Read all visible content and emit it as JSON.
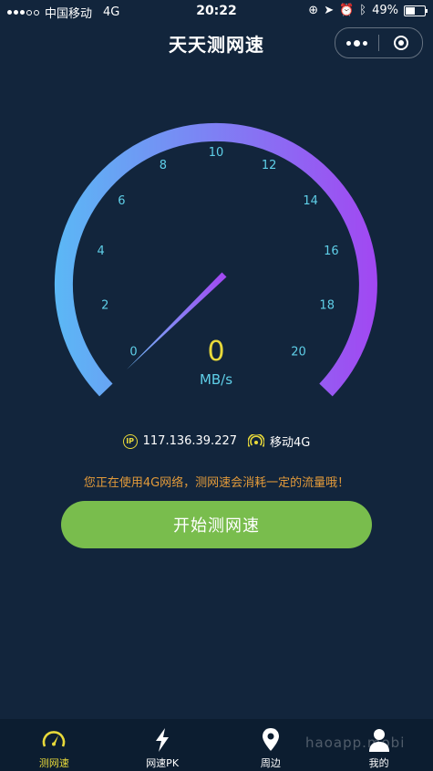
{
  "status_bar": {
    "carrier": "中国移动",
    "network": "4G",
    "time": "20:22",
    "battery": "49%",
    "battery_level": 0.49
  },
  "header": {
    "title": "天天测网速"
  },
  "gauge": {
    "ticks": [
      "0",
      "2",
      "4",
      "6",
      "8",
      "10",
      "12",
      "14",
      "16",
      "18",
      "20"
    ],
    "value": "0",
    "unit": "MB/s",
    "colors": {
      "start": "#5bb8f5",
      "end": "#a247f2"
    }
  },
  "network_info": {
    "ip": "117.136.39.227",
    "carrier_network": "移动4G",
    "ip_badge": "IP"
  },
  "warning": "您正在使用4G网络，测网速会消耗一定的流量哦！",
  "start_button": "开始测网速",
  "tabs": [
    {
      "label": "测网速",
      "icon": "speedometer-icon",
      "active": true
    },
    {
      "label": "网速PK",
      "icon": "lightning-icon",
      "active": false
    },
    {
      "label": "周边",
      "icon": "location-pin-icon",
      "active": false
    },
    {
      "label": "我的",
      "icon": "user-icon",
      "active": false
    }
  ],
  "watermark": "haoapp.mobi",
  "colors": {
    "background": "#12253c",
    "accent_yellow": "#e8d93a",
    "button_green": "#79bd4d",
    "warning_orange": "#e29a3a",
    "tick_cyan": "#5fcfe8"
  }
}
